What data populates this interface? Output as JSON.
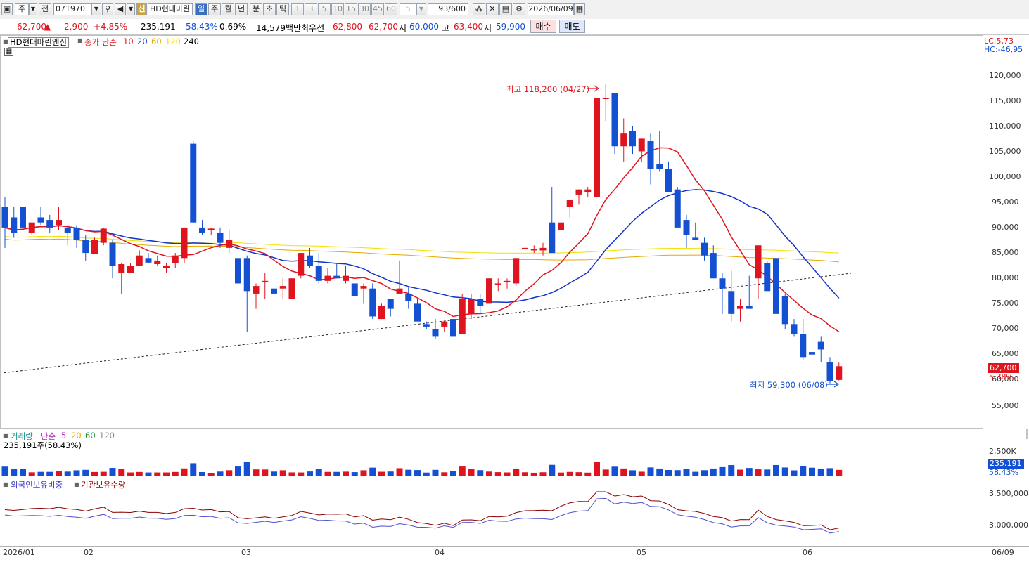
{
  "toolbar": {
    "market": "주",
    "kind": "전",
    "code": "071970",
    "stock_badge": "신",
    "stock_name": "HD현대마린",
    "periods": [
      "일",
      "주",
      "월",
      "년",
      "분",
      "초",
      "틱"
    ],
    "active_period": "일",
    "intervals": [
      "1",
      "3",
      "5",
      "10",
      "15",
      "30",
      "45",
      "60"
    ],
    "interval_value": "5",
    "count": "93/600",
    "date": "2026/06/09"
  },
  "quote": {
    "price": "62,700",
    "arrow": "▲",
    "change": "2,900",
    "change_pct": "+4.85%",
    "volume": "235,191",
    "vol_ratio": "58.43%",
    "turnover": "0.69%",
    "amount": "14,579백만",
    "best_label": "최우선",
    "best_ask": "62,800",
    "best_bid": "62,700",
    "open_label": "시",
    "open": "60,000",
    "high_label": "고",
    "high": "63,400",
    "low_label": "저",
    "low": "59,900",
    "buy": "매수",
    "sell": "매도"
  },
  "price_panel": {
    "title": "HD현대마린엔진",
    "indicator": "종가 단순",
    "ma_periods": [
      "10",
      "20",
      "60",
      "120",
      "240"
    ],
    "lc": "LC:5,73",
    "hc": "HC:-46,95",
    "y_ticks": [
      "120,000",
      "115,000",
      "110,000",
      "105,000",
      "100,000",
      "95,000",
      "90,000",
      "85,000",
      "80,000",
      "75,000",
      "70,000",
      "65,000",
      "60,000",
      "55,000"
    ],
    "current_tag": "62,700",
    "current_pct": "5.38%",
    "max_note": "최고 118,200 (04/27)",
    "min_note": "최저 59,300 (06/08)"
  },
  "volume_panel": {
    "title": "거래량",
    "indicator": "단순",
    "ma_periods": [
      "5",
      "20",
      "60",
      "120"
    ],
    "value": "235,191주(58.43%)",
    "y_tick": "2,500K",
    "current_tag": "235,191",
    "current_pct": "58.43%"
  },
  "holding_panel": {
    "series1": "외국인보유비중",
    "series2": "기관보유수량",
    "y_ticks": [
      "3,500,000",
      "3,000,000"
    ]
  },
  "x_axis": [
    "2026/01",
    "02",
    "03",
    "04",
    "05",
    "06",
    "06/09"
  ],
  "colors": {
    "up": "#e0141e",
    "down": "#1450d2",
    "ma10": "#e0141e",
    "ma20": "#1432c8",
    "ma60": "#e6a800",
    "ma120": "#f0e000"
  },
  "chart_data": {
    "type": "candlestick",
    "candles": [
      [
        94.0,
        96.0,
        86.0,
        90.0
      ],
      [
        92.0,
        94.0,
        88.0,
        89.0
      ],
      [
        94.0,
        96.0,
        89.0,
        90.0
      ],
      [
        89.0,
        91.0,
        88.5,
        91.0
      ],
      [
        92.0,
        94.0,
        90.5,
        91.0
      ],
      [
        91.5,
        92.5,
        89.0,
        90.0
      ],
      [
        90.5,
        94.0,
        89.5,
        91.5
      ],
      [
        90.0,
        90.5,
        86.5,
        89.0
      ],
      [
        90.0,
        90.5,
        86.0,
        87.5
      ],
      [
        87.5,
        88.5,
        83.5,
        85.0
      ],
      [
        84.8,
        88.0,
        85.0,
        87.6
      ],
      [
        87.0,
        90.0,
        86.5,
        89.8
      ],
      [
        87.0,
        87.5,
        80.0,
        82.5
      ],
      [
        81.0,
        83.0,
        77.0,
        82.8
      ],
      [
        81.0,
        83.0,
        81.0,
        82.5
      ],
      [
        82.5,
        85.5,
        82.5,
        84.5
      ],
      [
        84.0,
        85.0,
        83.0,
        83.1
      ],
      [
        82.8,
        84.5,
        82.5,
        83.5
      ],
      [
        82.0,
        83.0,
        81.0,
        82.5
      ],
      [
        83.0,
        85.0,
        82.0,
        84.5
      ],
      [
        84.0,
        90.0,
        83.0,
        90.0
      ],
      [
        106.5,
        107.0,
        91.0,
        91.0
      ],
      [
        90.0,
        91.5,
        88.5,
        89.0
      ],
      [
        89.5,
        90.0,
        88.5,
        89.8
      ],
      [
        89.0,
        90.0,
        86.0,
        87.0
      ],
      [
        86.0,
        89.5,
        85.0,
        87.5
      ],
      [
        84.0,
        90.0,
        81.0,
        79.0
      ],
      [
        84.0,
        84.5,
        69.5,
        77.5
      ],
      [
        77.0,
        79.0,
        74.0,
        78.5
      ],
      [
        79.5,
        81.0,
        76.0,
        79.5
      ],
      [
        78.0,
        80.0,
        76.5,
        77.0
      ],
      [
        78.0,
        80.0,
        76.0,
        78.5
      ],
      [
        76.0,
        78.0,
        76.0,
        80.0
      ],
      [
        80.5,
        82.0,
        80.0,
        85.0
      ],
      [
        84.5,
        86.0,
        82.0,
        82.5
      ],
      [
        82.5,
        85.0,
        79.0,
        79.5
      ],
      [
        79.5,
        82.0,
        79.0,
        80.5
      ],
      [
        80.5,
        83.0,
        80.0,
        80.0
      ],
      [
        79.5,
        82.5,
        79.0,
        80.5
      ],
      [
        79.0,
        79.0,
        76.5,
        76.5
      ],
      [
        78.0,
        79.0,
        75.0,
        78.5
      ],
      [
        78.0,
        79.0,
        72.0,
        72.5
      ],
      [
        72.0,
        75.0,
        72.0,
        74.5
      ],
      [
        76.0,
        76.0,
        72.5,
        74.0
      ],
      [
        77.0,
        83.5,
        77.0,
        78.0
      ],
      [
        77.0,
        78.5,
        74.0,
        75.5
      ],
      [
        75.0,
        76.0,
        72.0,
        71.5
      ],
      [
        71.0,
        71.5,
        70.0,
        70.5
      ],
      [
        70.0,
        72.0,
        68.0,
        68.5
      ],
      [
        70.5,
        71.5,
        69.5,
        71.5
      ],
      [
        72.0,
        72.0,
        68.5,
        68.5
      ],
      [
        69.0,
        77.0,
        69.0,
        76.0
      ],
      [
        73.0,
        77.0,
        72.0,
        76.0
      ],
      [
        76.0,
        77.0,
        73.0,
        74.5
      ],
      [
        75.0,
        80.0,
        76.5,
        80.0
      ],
      [
        79.0,
        80.0,
        77.5,
        79.0
      ],
      [
        79.5,
        80.0,
        78.0,
        79.5
      ],
      [
        79.0,
        84.0,
        78.5,
        84.0
      ],
      [
        86.0,
        87.0,
        84.5,
        86.0
      ],
      [
        85.5,
        86.5,
        85.0,
        85.8
      ],
      [
        85.5,
        87.0,
        84.5,
        86.0
      ],
      [
        91.0,
        98.0,
        86.0,
        85.0
      ],
      [
        89.5,
        90.0,
        88.0,
        91.0
      ],
      [
        94.0,
        95.5,
        92.0,
        95.5
      ],
      [
        96.5,
        97.5,
        94.5,
        97.5
      ],
      [
        97.0,
        98.0,
        96.0,
        97.5
      ],
      [
        96.0,
        115.5,
        96.0,
        115.5
      ],
      [
        115.5,
        118.2,
        111.0,
        115.5
      ],
      [
        116.5,
        116.5,
        104.5,
        106.0
      ],
      [
        106.0,
        111.5,
        103.0,
        108.5
      ],
      [
        109.0,
        110.0,
        104.5,
        106.0
      ],
      [
        105.0,
        107.5,
        103.0,
        107.5
      ],
      [
        107.0,
        108.5,
        98.5,
        101.5
      ],
      [
        102.5,
        109.0,
        101.0,
        101.5
      ],
      [
        101.5,
        103.0,
        97.5,
        97.0
      ],
      [
        97.5,
        98.0,
        93.0,
        90.0
      ],
      [
        91.5,
        92.5,
        86.0,
        88.5
      ],
      [
        88.0,
        91.0,
        87.5,
        87.5
      ],
      [
        87.0,
        88.0,
        83.5,
        84.5
      ],
      [
        85.0,
        86.5,
        80.0,
        80.0
      ],
      [
        80.0,
        81.0,
        73.0,
        78.0
      ],
      [
        77.5,
        81.5,
        71.5,
        73.0
      ],
      [
        74.0,
        76.0,
        71.5,
        74.5
      ],
      [
        74.5,
        80.5,
        74.0,
        74.0
      ],
      [
        80.0,
        81.5,
        76.0,
        86.5
      ],
      [
        83.0,
        83.5,
        78.5,
        77.5
      ],
      [
        84.0,
        84.5,
        74.0,
        73.0
      ],
      [
        76.5,
        77.0,
        70.0,
        71.0
      ],
      [
        71.0,
        72.0,
        68.5,
        69.0
      ],
      [
        69.0,
        72.0,
        64.0,
        64.5
      ],
      [
        65.5,
        71.0,
        65.0,
        65.0
      ],
      [
        67.5,
        68.5,
        63.5,
        66.0
      ],
      [
        63.5,
        64.5,
        59.3,
        59.8
      ],
      [
        60.0,
        63.4,
        59.9,
        62.7
      ]
    ]
  }
}
